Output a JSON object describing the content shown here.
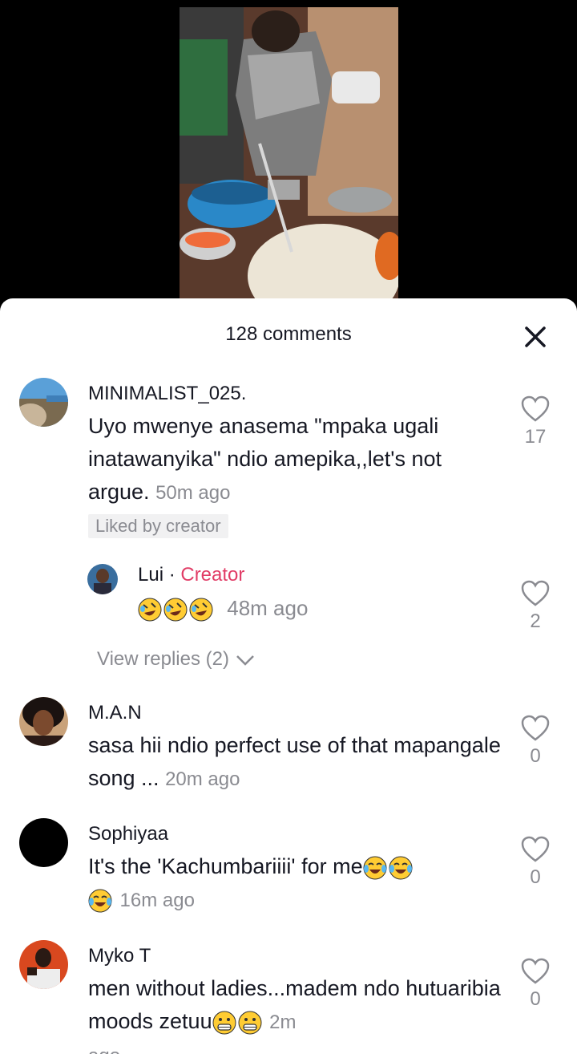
{
  "sheet": {
    "title": "128 comments"
  },
  "comments": [
    {
      "username": "MINIMALIST_025.",
      "text": "Uyo mwenye anasema \"mpaka ugali inatawanyika\" ndio amepika,,let's not argue.",
      "time": "50m ago",
      "liked_tag": "Liked by creator",
      "likes": "17"
    },
    {
      "username": "M.A.N",
      "text": "sasa hii ndio perfect use of that mapangale song ...",
      "time": "20m ago",
      "likes": "0"
    },
    {
      "username": "Sophiyaa",
      "text": "It's the 'Kachumbariiii' for me",
      "time": "16m ago",
      "likes": "0"
    },
    {
      "username": "Myko T",
      "text": "men without ladies...madem ndo hutuaribia moods zetuu",
      "time": "2m",
      "time_cont": "ago",
      "likes": "0"
    }
  ],
  "reply": {
    "username": "Lui",
    "sep": " · ",
    "badge": "Creator",
    "time": "48m ago",
    "likes": "2"
  },
  "view_replies": "View replies (2)",
  "icons": {
    "close": "close-icon",
    "like": "heart-outline-icon",
    "chevron": "chevron-down-icon",
    "emoji_rofl": "rolling-laughing-emoji",
    "emoji_joy": "tears-of-joy-emoji",
    "emoji_grin": "grinning-emoji"
  },
  "colors": {
    "creator": "#e13c66",
    "muted": "#8a8b91",
    "text": "#161823"
  }
}
